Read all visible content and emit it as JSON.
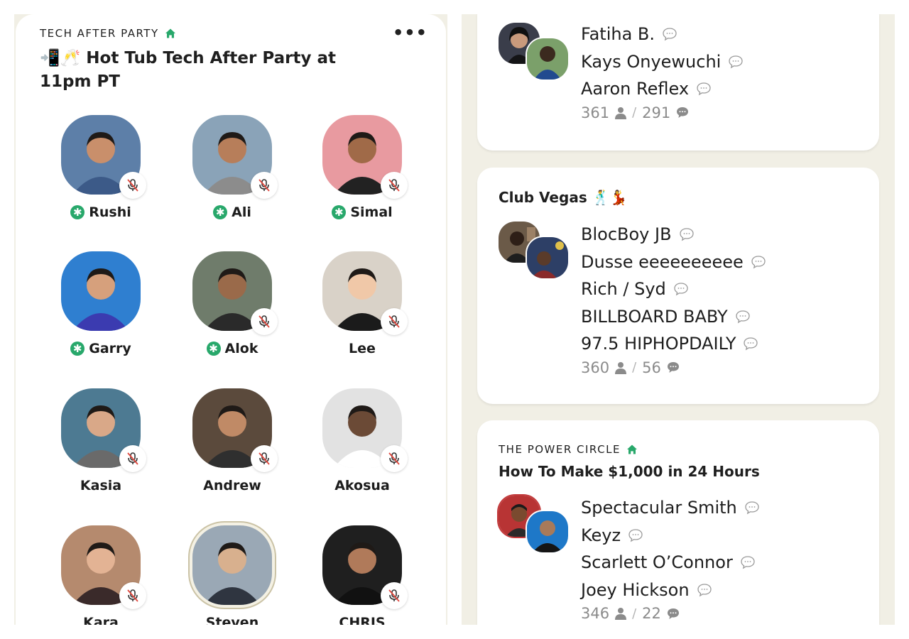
{
  "room": {
    "club": "TECH AFTER PARTY",
    "title": "📲🥂 Hot Tub Tech After Party at 11pm PT",
    "speakers": [
      {
        "name": "Rushi",
        "moderator": true,
        "muted": true,
        "color": "#5d7fa8"
      },
      {
        "name": "Ali",
        "moderator": true,
        "muted": true,
        "color": "#8aa3b8"
      },
      {
        "name": "Simal",
        "moderator": true,
        "muted": true,
        "color": "#e89aa0"
      },
      {
        "name": "Garry",
        "moderator": true,
        "muted": false,
        "color": "#2f7fd0"
      },
      {
        "name": "Alok",
        "moderator": true,
        "muted": true,
        "color": "#6f7c6b"
      },
      {
        "name": "Lee",
        "moderator": false,
        "muted": true,
        "color": "#d9d2c8"
      },
      {
        "name": "Kasia",
        "moderator": false,
        "muted": true,
        "color": "#4d7a92"
      },
      {
        "name": "Andrew",
        "moderator": false,
        "muted": true,
        "color": "#5b4a3c"
      },
      {
        "name": "Akosua",
        "moderator": false,
        "muted": true,
        "color": "#e2e2e2"
      },
      {
        "name": "Kara",
        "moderator": false,
        "muted": true,
        "color": "#b58a6e"
      },
      {
        "name": "Steven",
        "moderator": false,
        "muted": false,
        "color": "#9aa8b5"
      },
      {
        "name": "CHRIS",
        "moderator": false,
        "muted": true,
        "color": "#1f1f1f"
      }
    ]
  },
  "rooms": [
    {
      "club": "",
      "title": "",
      "members": [
        "Fatiha B.",
        "Kays Onyewuchi",
        "Aaron Reflex"
      ],
      "listeners": "361",
      "speakers_count": "291",
      "avatar_colors": [
        "#2a2a33",
        "#1f4a86"
      ]
    },
    {
      "club": "",
      "title": "Club Vegas 🕺💃",
      "members": [
        "BlocBoy JB",
        "Dusse eeeeeeeeee",
        "Rich / Syd",
        "BILLBOARD BABY",
        "97.5 HIPHOPDAILY"
      ],
      "listeners": "360",
      "speakers_count": "56",
      "avatar_colors": [
        "#5a4a3a",
        "#2c3e6a"
      ]
    },
    {
      "club": "THE POWER CIRCLE",
      "title": "How To Make $1,000 in 24 Hours",
      "members": [
        "Spectacular Smith",
        "Keyz",
        "Scarlett O’Connor",
        "Joey Hickson"
      ],
      "listeners": "346",
      "speakers_count": "22",
      "avatar_colors": [
        "#c2393b",
        "#1e78c8"
      ]
    }
  ],
  "colors": {
    "accent_green": "#28a86b",
    "background": "#f1efe5",
    "muted_text": "#8b8b8b"
  },
  "icons": {
    "club": "house-icon",
    "more": "more-icon",
    "muted": "mic-muted-icon",
    "moderator": "moderator-badge-icon",
    "chat": "speech-bubble-icon",
    "person": "person-icon"
  }
}
